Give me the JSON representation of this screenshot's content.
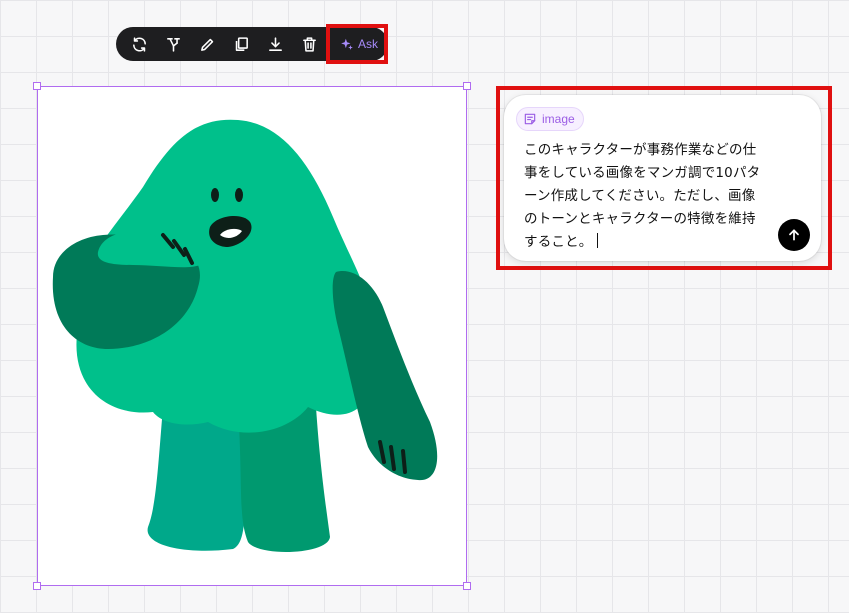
{
  "toolbar": {
    "icons": [
      "refresh-icon",
      "fork-icon",
      "pencil-icon",
      "copy-icon",
      "download-icon",
      "trash-icon",
      "sparkle-icon"
    ],
    "ask_label": "Ask"
  },
  "prompt": {
    "chip_label": "image",
    "chip_icon": "note-icon",
    "text": "このキャラクターが事務作業などの仕事をしている画像をマンガ調で10パターン作成してください。ただし、画像のトーンとキャラクターの特徴を維持すること。",
    "send_icon": "arrow-up-icon"
  },
  "colors": {
    "accent": "#a78bfa",
    "selection": "#b06cf0",
    "highlight": "#e01010",
    "character_main": "#00c08b",
    "character_dark": "#007a58"
  }
}
